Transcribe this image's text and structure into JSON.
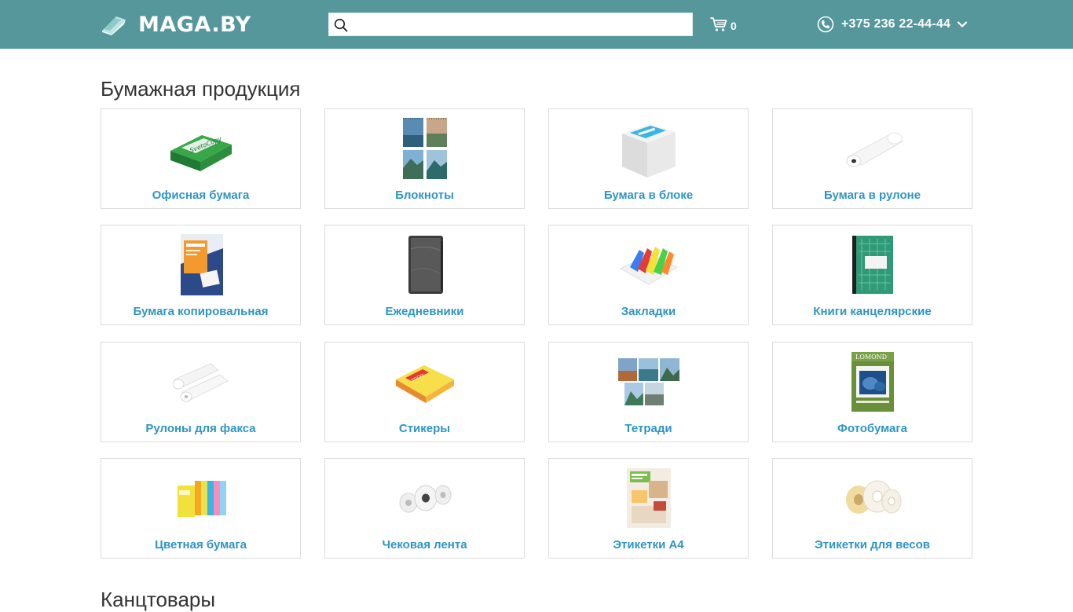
{
  "header": {
    "logo_text": "MAGA.BY",
    "search": {
      "placeholder": "",
      "value": ""
    },
    "cart_count": "0",
    "phone": "+375 236 22-44-44"
  },
  "colors": {
    "header_bg": "#55979b",
    "link": "#2f95c4",
    "title": "#333333"
  },
  "sections": [
    {
      "title": "Бумажная продукция",
      "items": [
        {
          "label": "Офисная бумага",
          "icon": "paper-ream-icon"
        },
        {
          "label": "Блокноты",
          "icon": "notebook-icon"
        },
        {
          "label": "Бумага в блоке",
          "icon": "paper-cube-icon"
        },
        {
          "label": "Бумага в рулоне",
          "icon": "paper-roll-icon"
        },
        {
          "label": "Бумага копировальная",
          "icon": "carbon-paper-icon"
        },
        {
          "label": "Ежедневники",
          "icon": "diary-icon"
        },
        {
          "label": "Закладки",
          "icon": "bookmarks-icon"
        },
        {
          "label": "Книги канцелярские",
          "icon": "ledger-book-icon"
        },
        {
          "label": "Рулоны для факса",
          "icon": "fax-rolls-icon"
        },
        {
          "label": "Стикеры",
          "icon": "sticky-notes-icon"
        },
        {
          "label": "Тетради",
          "icon": "copybooks-icon"
        },
        {
          "label": "Фотобумага",
          "icon": "photo-paper-icon"
        },
        {
          "label": "Цветная бумага",
          "icon": "colored-paper-icon"
        },
        {
          "label": "Чековая лента",
          "icon": "receipt-rolls-icon"
        },
        {
          "label": "Этикетки А4",
          "icon": "labels-a4-icon"
        },
        {
          "label": "Этикетки для весов",
          "icon": "scale-labels-icon"
        }
      ]
    },
    {
      "title": "Канцтовары"
    }
  ]
}
